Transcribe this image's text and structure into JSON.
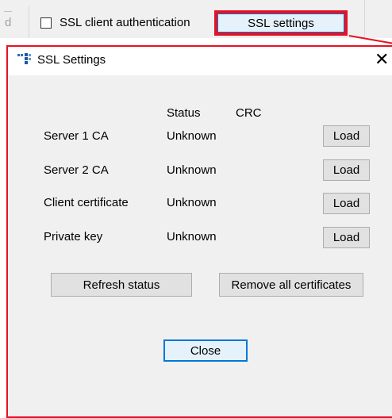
{
  "parent": {
    "fragment_text": "d",
    "ssl_client_auth": {
      "label": "SSL client authentication",
      "checked": false
    },
    "ssl_settings_button": "SSL settings",
    "highlight_color": "#e81123"
  },
  "dialog": {
    "title": "SSL Settings",
    "close_glyph": "✕",
    "columns": {
      "status": "Status",
      "crc": "CRC"
    },
    "rows": [
      {
        "label": "Server 1 CA",
        "status": "Unknown",
        "crc": "",
        "button": "Load"
      },
      {
        "label": "Server 2 CA",
        "status": "Unknown",
        "crc": "",
        "button": "Load"
      },
      {
        "label": "Client certificate",
        "status": "Unknown",
        "crc": "",
        "button": "Load"
      },
      {
        "label": "Private key",
        "status": "Unknown",
        "crc": "",
        "button": "Load"
      }
    ],
    "refresh_button": "Refresh status",
    "remove_button": "Remove all certificates",
    "close_button": "Close",
    "focus_color": "#0078d7"
  }
}
